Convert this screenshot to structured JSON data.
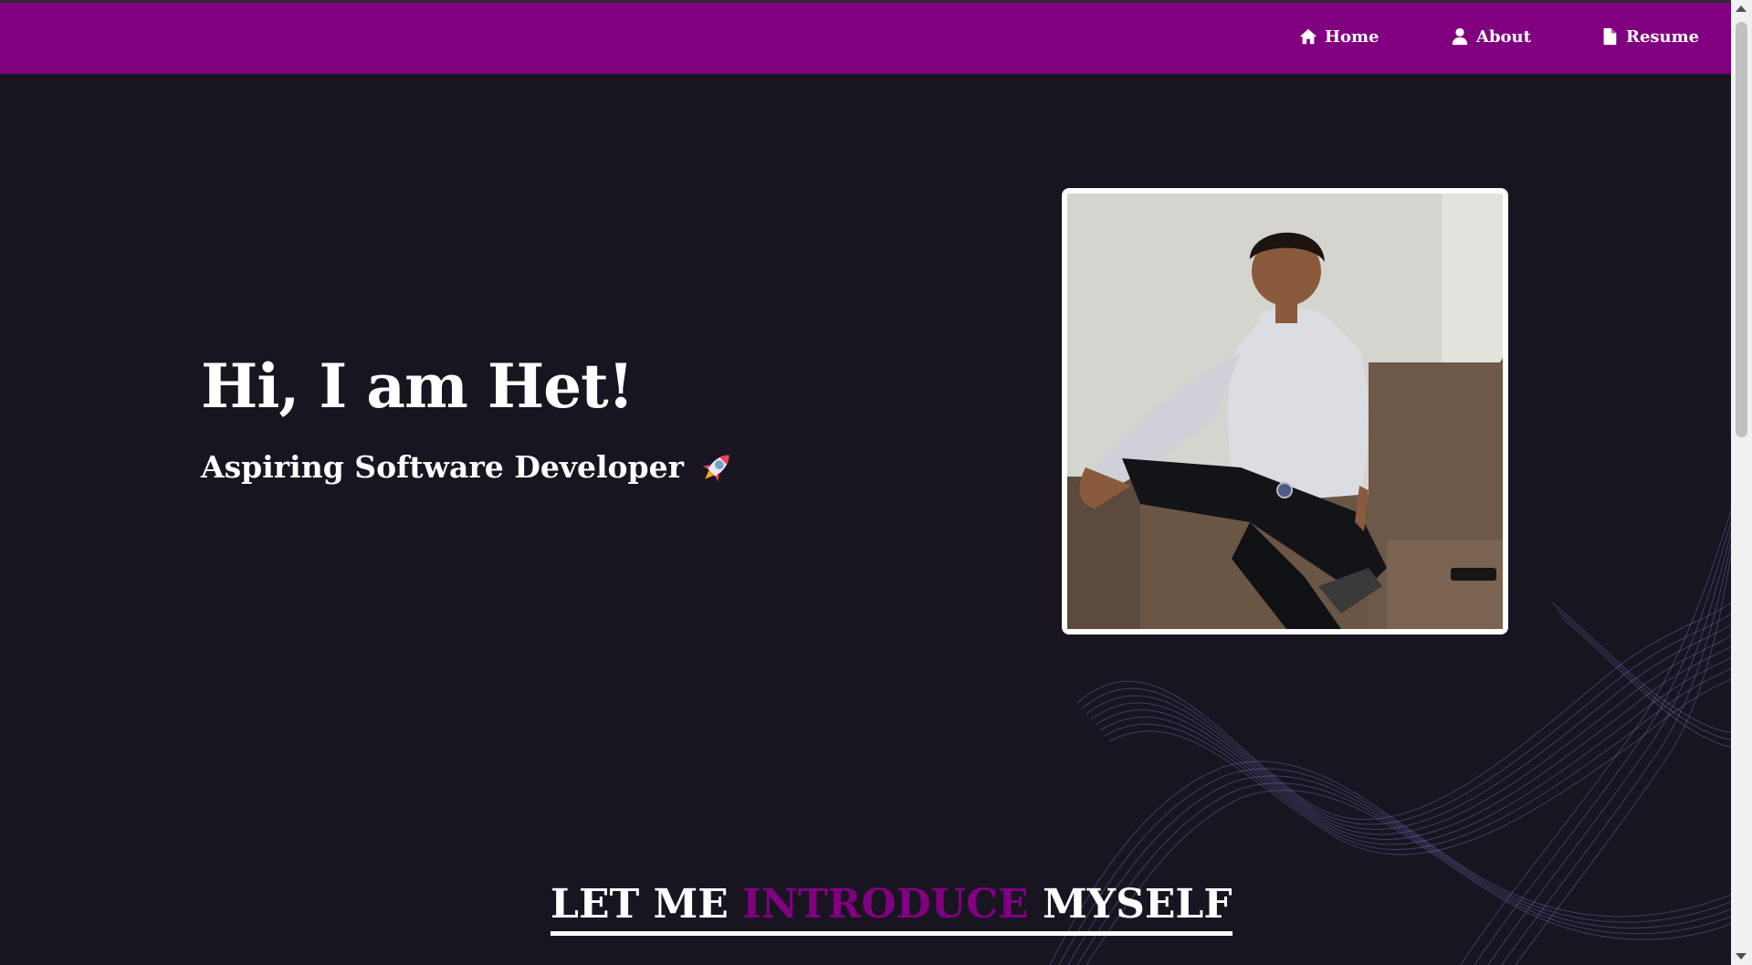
{
  "nav": {
    "items": [
      {
        "label": "Home",
        "icon": "home-icon"
      },
      {
        "label": "About",
        "icon": "user-icon"
      },
      {
        "label": "Resume",
        "icon": "document-icon"
      }
    ]
  },
  "hero": {
    "title": "Hi, I am Het!",
    "subtitle": "Aspiring Software Developer",
    "subtitle_icon": "rocket-icon",
    "photo_alt": "portrait-photo"
  },
  "intro": {
    "part1": "LET ME",
    "part2": "INTRODUCE",
    "part3": "MYSELF"
  },
  "colors": {
    "navbar": "#800080",
    "background": "#181521",
    "accent": "#800080",
    "text": "#ffffff"
  }
}
